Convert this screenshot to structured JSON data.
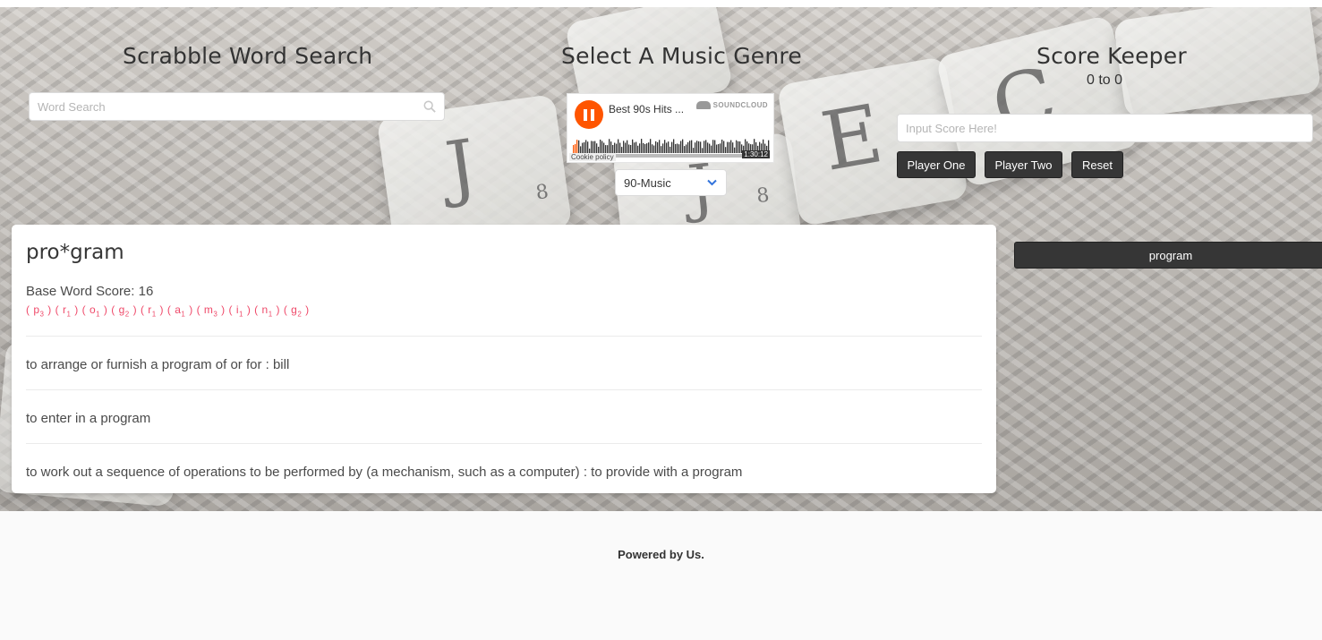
{
  "search": {
    "title": "Scrabble Word Search",
    "placeholder": "Word Search"
  },
  "music": {
    "title": "Select A Music Genre",
    "player": {
      "track_title": "Best 90s Hits ...",
      "brand": "SOUNDCLOUD",
      "cookie_label": "Cookie policy",
      "duration": "1:30:12"
    },
    "genre_selected": "90-Music"
  },
  "score_keeper": {
    "title": "Score Keeper",
    "score_text": "0 to 0",
    "input_placeholder": "Input Score Here!",
    "buttons": {
      "player_one": "Player One",
      "player_two": "Player Two",
      "reset": "Reset"
    }
  },
  "result": {
    "headword": "pro*gram",
    "base_score_text": "Base Word Score: 16",
    "letters": [
      {
        "letter": "p",
        "score": "3"
      },
      {
        "letter": "r",
        "score": "1"
      },
      {
        "letter": "o",
        "score": "1"
      },
      {
        "letter": "g",
        "score": "2"
      },
      {
        "letter": "r",
        "score": "1"
      },
      {
        "letter": "a",
        "score": "1"
      },
      {
        "letter": "m",
        "score": "3"
      },
      {
        "letter": "i",
        "score": "1"
      },
      {
        "letter": "n",
        "score": "1"
      },
      {
        "letter": "g",
        "score": "2"
      }
    ],
    "definitions": [
      "to arrange or furnish a program of or for : bill",
      "to enter in a program",
      "to work out a sequence of operations to be performed by (a mechanism, such as a computer) : to provide with a program"
    ]
  },
  "history": {
    "items": [
      "program"
    ]
  },
  "footer": {
    "text": "Powered by Us."
  },
  "colors": {
    "dark_button": "#363636",
    "soundcloud_orange": "#ff5500",
    "letter_score_pink": "#ef4a6a"
  },
  "icons": {
    "search": "search-icon",
    "pause": "pause-icon",
    "dropdown": "chevron-down-icon",
    "soundcloud": "soundcloud-logo-icon"
  }
}
